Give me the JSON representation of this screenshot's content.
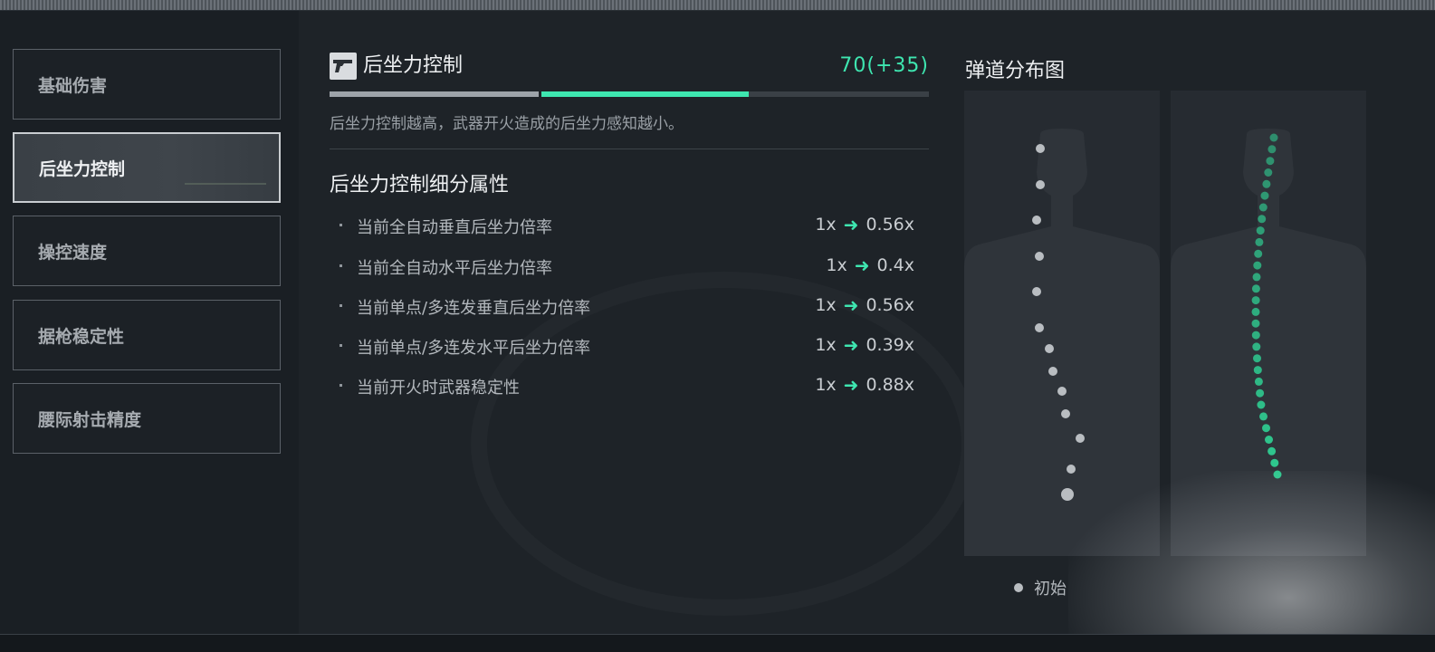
{
  "sidebar": {
    "items": [
      {
        "label": "基础伤害"
      },
      {
        "label": "后坐力控制"
      },
      {
        "label": "操控速度"
      },
      {
        "label": "据枪稳定性"
      },
      {
        "label": "腰际射击精度"
      }
    ],
    "active_index": 1
  },
  "stat": {
    "title": "后坐力控制",
    "icon": "pistol-icon",
    "value_text": "70(+35)",
    "base_fraction": 0.35,
    "total_fraction": 0.7,
    "description": "后坐力控制越高，武器开火造成的后坐力感知越小。"
  },
  "breakdown": {
    "title": "后坐力控制细分属性",
    "rows": [
      {
        "label": "当前全自动垂直后坐力倍率",
        "before": "1x",
        "after": "0.56x"
      },
      {
        "label": "当前全自动水平后坐力倍率",
        "before": "1x",
        "after": "0.4x"
      },
      {
        "label": "当前单点/多连发垂直后坐力倍率",
        "before": "1x",
        "after": "0.56x"
      },
      {
        "label": "当前单点/多连发水平后坐力倍率",
        "before": "1x",
        "after": "0.39x"
      },
      {
        "label": "当前开火时武器稳定性",
        "before": "1x",
        "after": "0.88x"
      }
    ]
  },
  "spread": {
    "title": "弹道分布图",
    "legend_label": "初始"
  },
  "colors": {
    "accent_green": "#3ee6b0",
    "base_gray": "#9da3a9",
    "initial_dots": "#b9bdc1",
    "improved_dots": "#2fc98f"
  }
}
